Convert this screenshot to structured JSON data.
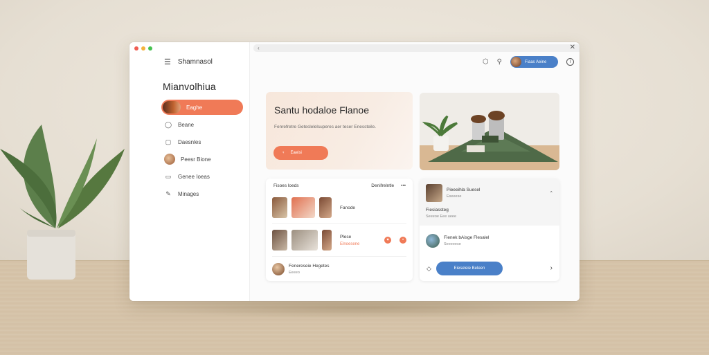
{
  "window": {
    "sidebar": {
      "menu_label": "Shamnasol",
      "title": "Mianvolhiua",
      "items": [
        {
          "label": "Eaghe",
          "icon": "avatar-icon",
          "active": true
        },
        {
          "label": "Beane",
          "icon": "chat-icon"
        },
        {
          "label": "Daesnles",
          "icon": "message-icon"
        },
        {
          "label": "Peesr Bione",
          "icon": "avatar-icon"
        },
        {
          "label": "Genee Ioeas",
          "icon": "document-icon"
        },
        {
          "label": "Minages",
          "icon": "pencil-icon"
        }
      ]
    },
    "toolbar": {
      "url": "",
      "user_label": "Fiaas Aeine"
    },
    "hero": {
      "title": "Santu hodaloe Flanoe",
      "text": "Fenrefretre Geteslelelsuperes aer teser Enessteile.",
      "button_label": "Eaeisi"
    },
    "feed": {
      "header_left": "Fisoes loeds",
      "header_right": "Denifrelntle",
      "rows": [
        {
          "label": "Fanode"
        },
        {
          "label": "Plese",
          "tag": "Elnoesene"
        },
        {
          "label": "Fenereseie Hegetes",
          "sub": "Eeeeo"
        }
      ]
    },
    "messages": {
      "rows": [
        {
          "title": "Pieeeihla Suesel",
          "sub": "Eseeese"
        },
        {
          "title": "Fiesiassteg",
          "sub": "Seeeoe Eee ueee"
        },
        {
          "title": "Fienek bAisge Flesalel",
          "sub": "Seeeeese"
        }
      ],
      "share_label": "Eieseleie Beleen"
    }
  },
  "colors": {
    "accent": "#f07a57",
    "primary": "#4a80c8"
  }
}
